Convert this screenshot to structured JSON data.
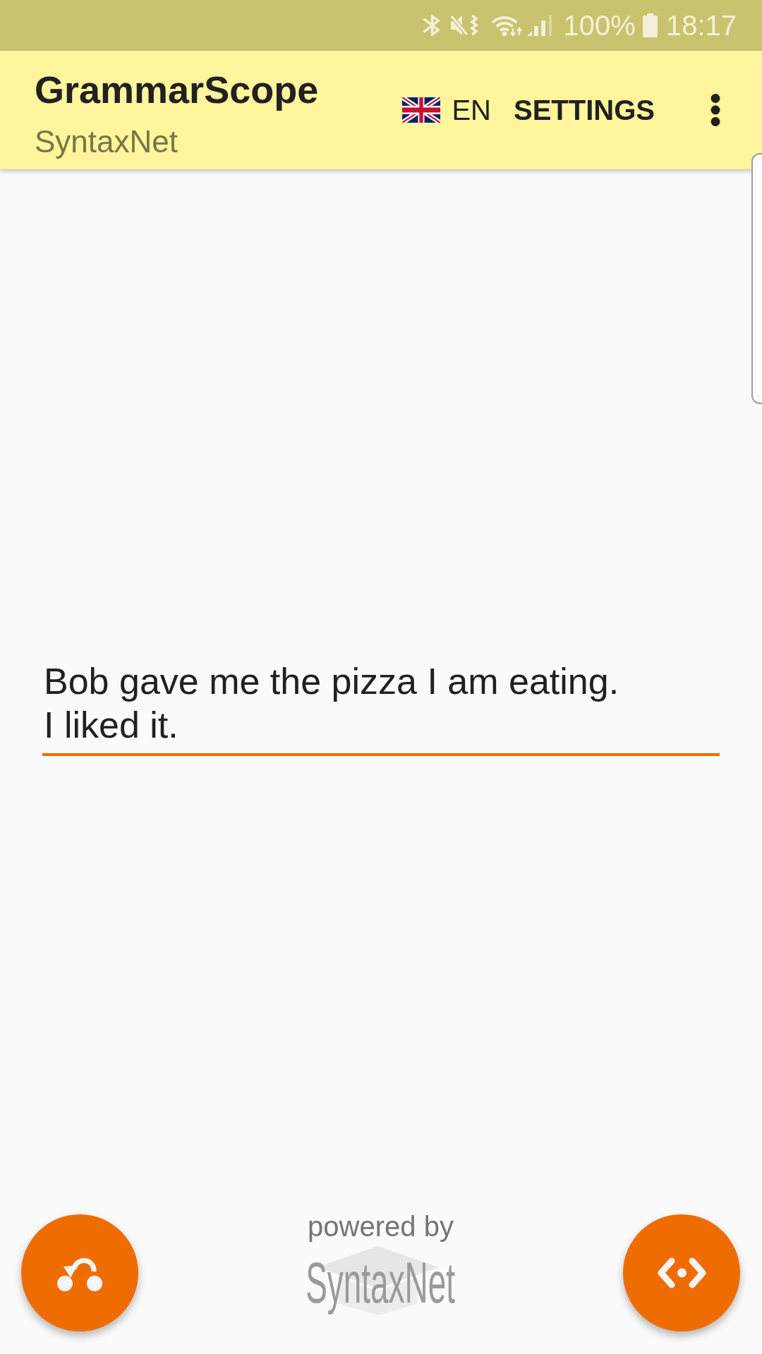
{
  "status_bar": {
    "battery": "100%",
    "time": "18:17"
  },
  "app_bar": {
    "title": "GrammarScope",
    "subtitle": "SyntaxNet",
    "language": "EN",
    "settings": "SETTINGS"
  },
  "editor": {
    "value": "Bob gave me the pizza I am eating.\nI liked it."
  },
  "footer": {
    "caption": "powered by",
    "logo": "SyntaxNet"
  }
}
